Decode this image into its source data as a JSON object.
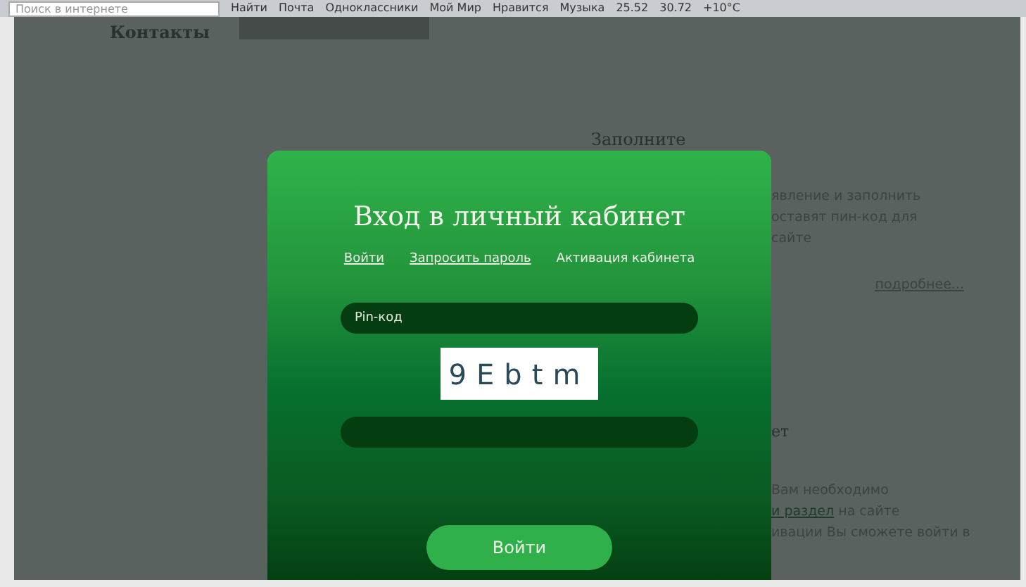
{
  "browser_toolbar": {
    "search_placeholder": "Поиск в интернете",
    "search_button": "Найти",
    "links": [
      "Почта",
      "Одноклассники",
      "Мой Мир",
      "Нравится",
      "Музыка",
      "25.52",
      "30.72",
      "+10°C"
    ]
  },
  "background_page": {
    "nav_item": "Контакты",
    "heading": "Заполните",
    "paragraph_1": [
      "явление и заполнить",
      "оставят пин-код для",
      "сайте"
    ],
    "more_link": "подробнее...",
    "heading_2": "ет",
    "paragraph_2": [
      {
        "text": "Вам необходимо"
      },
      {
        "link": "и раздел",
        "text": " на сайте"
      },
      {
        "text": "ивации Вы сможете войти в"
      }
    ]
  },
  "modal": {
    "title": "Вход в личный кабинет",
    "tabs": [
      {
        "label": "Войти",
        "selected": false
      },
      {
        "label": "Запросить пароль",
        "selected": false
      },
      {
        "label": "Активация кабинета",
        "selected": true
      }
    ],
    "pin_field": {
      "placeholder": "Pin-код"
    },
    "captcha": "9Ebtm",
    "submit": "Войти"
  }
}
